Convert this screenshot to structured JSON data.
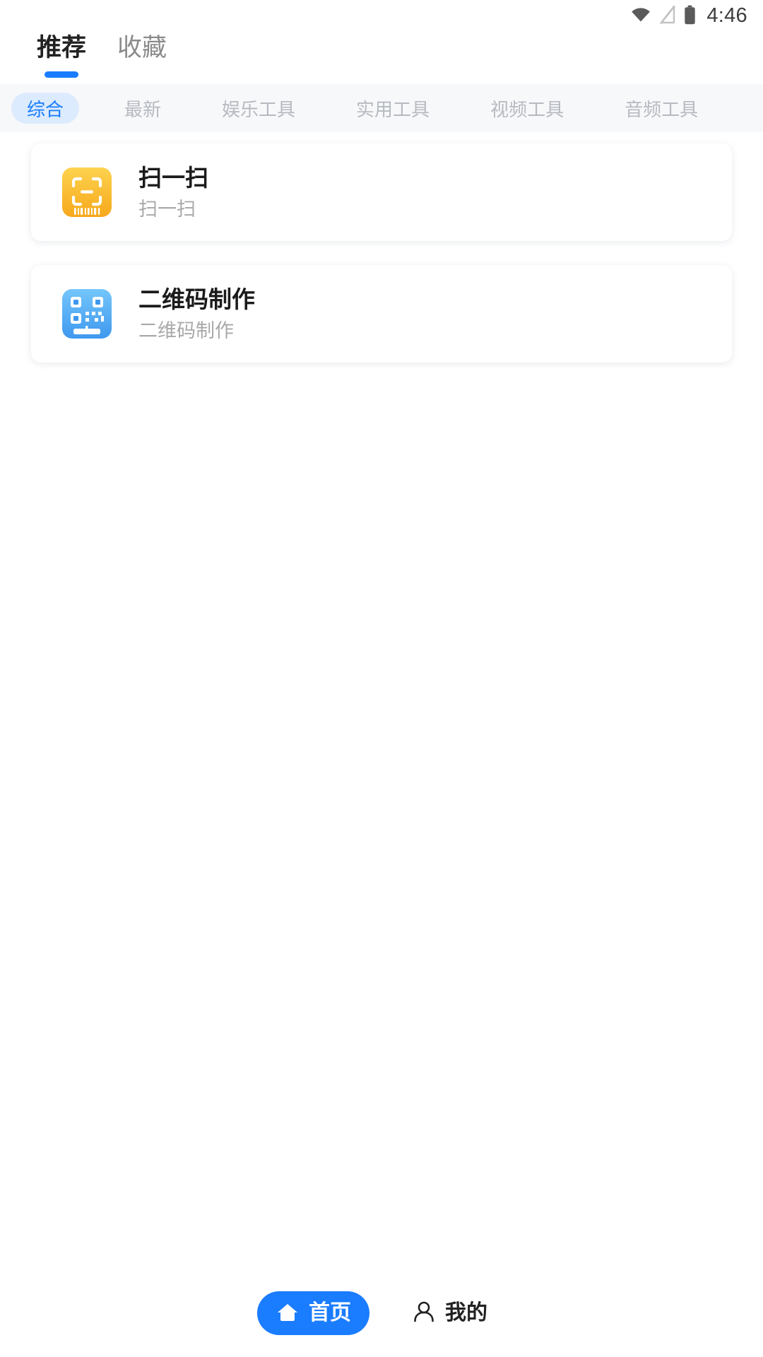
{
  "status_bar": {
    "time": "4:46",
    "icons": [
      "wifi-icon",
      "signal-off-icon",
      "battery-icon"
    ]
  },
  "top_tabs": [
    {
      "label": "推荐",
      "active": true
    },
    {
      "label": "收藏",
      "active": false
    }
  ],
  "category_chips": [
    {
      "label": "综合",
      "active": true
    },
    {
      "label": "最新",
      "active": false
    },
    {
      "label": "娱乐工具",
      "active": false
    },
    {
      "label": "实用工具",
      "active": false
    },
    {
      "label": "视频工具",
      "active": false
    },
    {
      "label": "音频工具",
      "active": false
    }
  ],
  "tool_list": [
    {
      "title": "扫一扫",
      "subtitle": "扫一扫",
      "icon": "scan-barcode-icon",
      "icon_color": "#fcc02e"
    },
    {
      "title": "二维码制作",
      "subtitle": "二维码制作",
      "icon": "qr-code-icon",
      "icon_color": "#4aa8f5"
    }
  ],
  "bottom_nav": [
    {
      "label": "首页",
      "icon": "home-icon",
      "active": true
    },
    {
      "label": "我的",
      "icon": "user-icon",
      "active": false
    }
  ],
  "colors": {
    "accent": "#1a7cff",
    "chip_active_bg": "#dcebfd",
    "chip_bar_bg": "#f7f8fa",
    "scan_icon": "#fcc02e",
    "qr_icon": "#4aa8f5",
    "title_text": "#1b1b1b",
    "muted_text": "#a9a9a9"
  }
}
